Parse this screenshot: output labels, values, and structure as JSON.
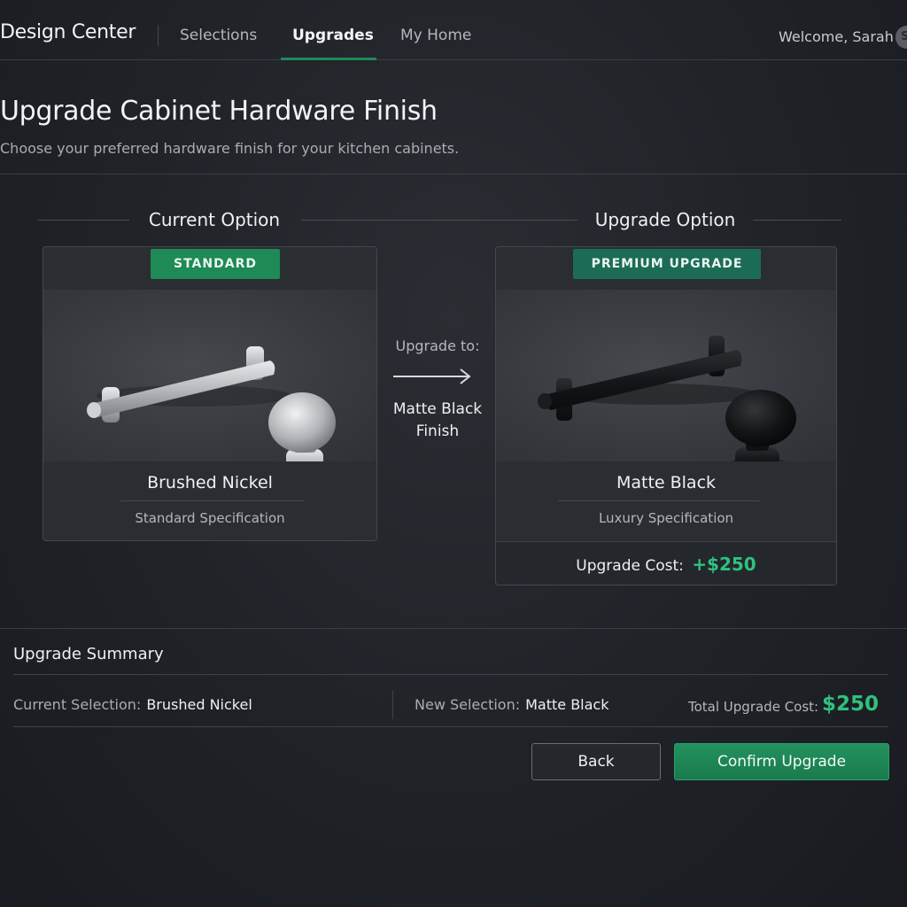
{
  "nav": {
    "brand": "Design Center",
    "links": [
      "Selections",
      "Upgrades",
      "My Home"
    ],
    "active": "Upgrades",
    "welcome": "Welcome, Sarah",
    "avatar_initial": "S"
  },
  "header": {
    "title": "Upgrade Cabinet Hardware Finish",
    "subtitle": "Choose your preferred hardware finish for your kitchen cabinets."
  },
  "current": {
    "section_title": "Current Option",
    "badge": "STANDARD",
    "name": "Brushed Nickel",
    "spec": "Standard Specification",
    "finish_color": "#b9bcc0"
  },
  "upgrade": {
    "section_title": "Upgrade Option",
    "badge": "PREMIUM UPGRADE",
    "name": "Matte Black",
    "spec": "Luxury Specification",
    "cost_label": "Upgrade Cost:",
    "cost_value": "+$250",
    "finish_color": "#111214"
  },
  "middle": {
    "label": "Upgrade to:",
    "finish": "Matte Black Finish",
    "arrow_icon": "arrow-right-icon"
  },
  "summary": {
    "title": "Upgrade Summary",
    "current_label": "Current Selection:",
    "current_value": "Brushed Nickel",
    "new_label": "New Selection:",
    "new_value": "Matte Black",
    "total_label": "Total Upgrade Cost:",
    "total_value": "$250"
  },
  "buttons": {
    "back": "Back",
    "confirm": "Confirm Upgrade"
  },
  "colors": {
    "accent": "#1e8a55",
    "price": "#2ec27e"
  }
}
